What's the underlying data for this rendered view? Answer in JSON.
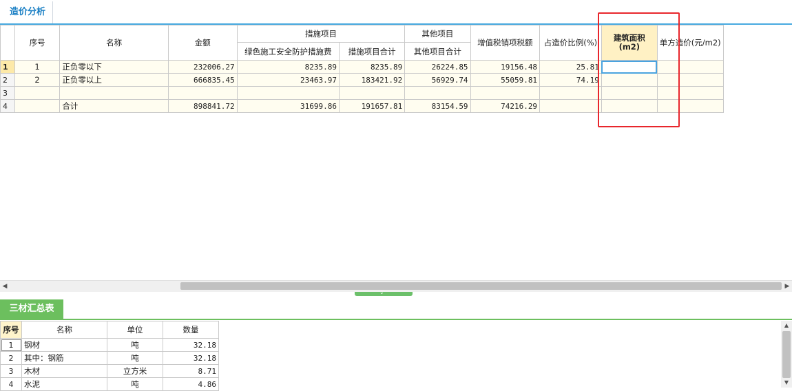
{
  "top_tab": {
    "label": "造价分析"
  },
  "main_table": {
    "headers": {
      "seq": "序号",
      "name": "名称",
      "amount": "金额",
      "measures_group": "措施项目",
      "green_safety": "绿色施工安全防护措施费",
      "measures_total": "措施项目合计",
      "other_group": "其他项目",
      "other_total": "其他项目合计",
      "vat": "增值税销项税额",
      "ratio": "占造价比例(%)",
      "area_line1": "建筑面积",
      "area_line2": "(m2)",
      "unit_price": "单方造价(元/m2)"
    },
    "rows": [
      {
        "rownum": "1",
        "seq": "1",
        "name": "正负零以下",
        "amount": "232006.27",
        "green_safety": "8235.89",
        "measures_total": "8235.89",
        "other_total": "26224.85",
        "vat": "19156.48",
        "ratio": "25.81",
        "area": "",
        "unit_price": ""
      },
      {
        "rownum": "2",
        "seq": "2",
        "name": "正负零以上",
        "amount": "666835.45",
        "green_safety": "23463.97",
        "measures_total": "183421.92",
        "other_total": "56929.74",
        "vat": "55059.81",
        "ratio": "74.19",
        "area": "",
        "unit_price": ""
      },
      {
        "rownum": "3",
        "seq": "",
        "name": "",
        "amount": "",
        "green_safety": "",
        "measures_total": "",
        "other_total": "",
        "vat": "",
        "ratio": "",
        "area": "",
        "unit_price": ""
      },
      {
        "rownum": "4",
        "seq": "",
        "name": "合计",
        "amount": "898841.72",
        "green_safety": "31699.86",
        "measures_total": "191657.81",
        "other_total": "83154.59",
        "vat": "74216.29",
        "ratio": "",
        "area": "",
        "unit_price": ""
      }
    ]
  },
  "bottom_tab": {
    "label": "三材汇总表"
  },
  "materials_table": {
    "headers": {
      "seq": "序号",
      "name": "名称",
      "unit": "单位",
      "qty": "数量"
    },
    "rows": [
      {
        "seq": "1",
        "name": "钢材",
        "unit": "吨",
        "qty": "32.18"
      },
      {
        "seq": "2",
        "name": "其中：钢筋",
        "unit": "吨",
        "qty": "32.18"
      },
      {
        "seq": "3",
        "name": "木材",
        "unit": "立方米",
        "qty": "8.71"
      },
      {
        "seq": "4",
        "name": "水泥",
        "unit": "吨",
        "qty": "4.86"
      }
    ]
  },
  "colors": {
    "tab_blue": "#1a7fc4",
    "green_tab": "#6cbf5e",
    "annotation_red": "#e8262c",
    "selected_header": "#fff1c4"
  },
  "icons": {
    "scroll_left": "scroll-left-icon",
    "scroll_right": "scroll-right-icon",
    "scroll_up": "scroll-up-icon",
    "scroll_down": "scroll-down-icon",
    "splitter": "chevron-down-icon"
  }
}
